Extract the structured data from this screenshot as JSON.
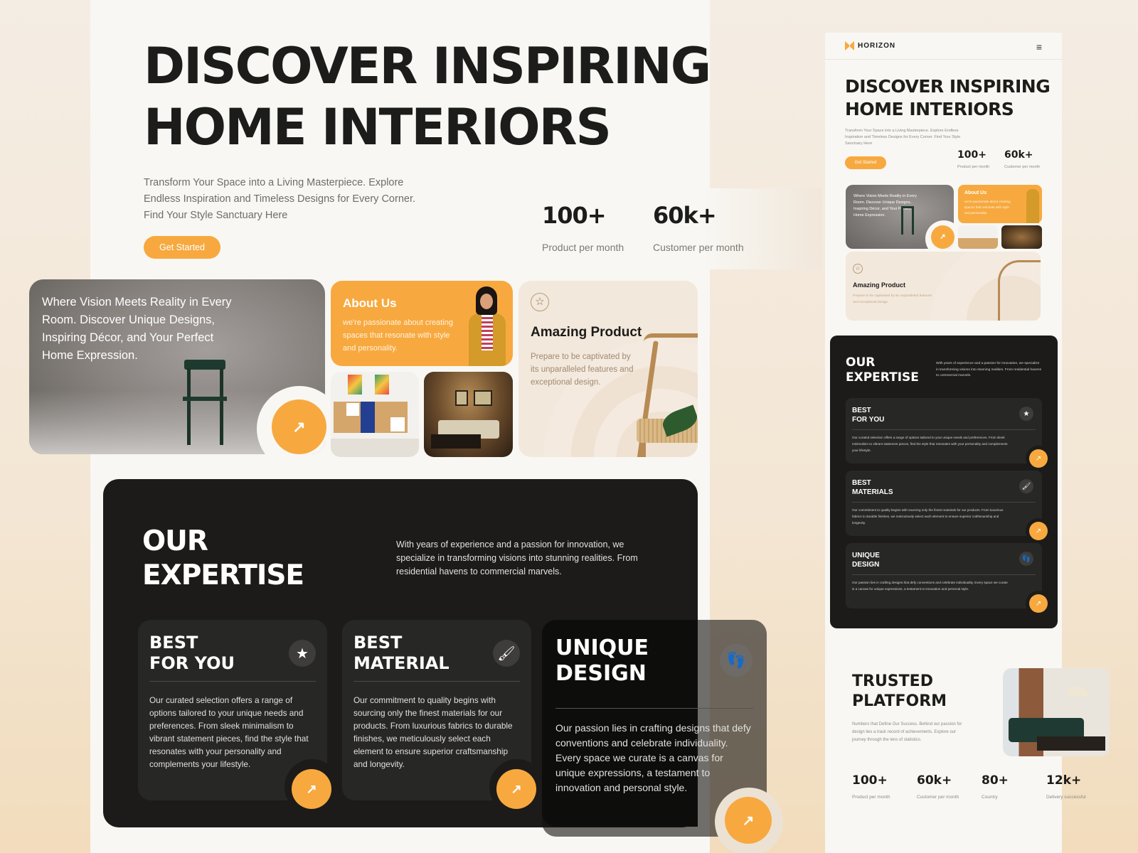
{
  "colors": {
    "accent": "#f7a93f",
    "dark": "#1c1b19",
    "card_dark": "#272725",
    "canvas": "#f8f7f3",
    "text": "#1c1c1a"
  },
  "hero": {
    "title_line1": "DISCOVER INSPIRING",
    "title_line2": "HOME INTERIORS",
    "subtitle": "Transform Your Space into a Living Masterpiece. Explore Endless Inspiration and Timeless Designs for Every Corner. Find Your Style Sanctuary Here",
    "cta_label": "Get Started"
  },
  "stats": [
    {
      "value": "100+",
      "label": "Product per month"
    },
    {
      "value": "60k+",
      "label": "Customer per month"
    }
  ],
  "vision_card": {
    "text": "Where Vision Meets Reality in Every Room. Discover Unique Designs, Inspiring Décor, and Your Perfect Home Expression.",
    "arrow_icon": "arrow-up-right-icon"
  },
  "about_card": {
    "title": "About Us",
    "text": "we're passionate about creating spaces that resonate with style and personality."
  },
  "amazing_card": {
    "icon": "star-outline-icon",
    "title": "Amazing Product",
    "text": "Prepare to be captivated by its unparalleled features and exceptional design."
  },
  "expertise": {
    "title_line1": "OUR",
    "title_line2": "EXPERTISE",
    "description": "With years of experience and a passion for innovation, we specialize in transforming visions into stunning realities. From residential havens to commercial marvels.",
    "cards": [
      {
        "title_line1": "BEST",
        "title_line2": "FOR YOU",
        "icon": "star-icon",
        "text": "Our curated selection offers a range of options tailored to your unique needs and preferences. From sleek minimalism to vibrant statement pieces, find the style that resonates with your personality and complements your lifestyle."
      },
      {
        "title_line1": "BEST",
        "title_line2": "MATERIAL",
        "icon": "paint-roller-icon",
        "text": "Our commitment to quality begins with sourcing only the finest materials for our products. From luxurious fabrics to durable finishes, we meticulously select each element to ensure superior craftsmanship and longevity."
      },
      {
        "title_line1": "UNIQUE",
        "title_line2": "DESIGN",
        "icon": "footprints-icon",
        "text": "Our passion lies in crafting designs that defy conventions and celebrate individuality. Every space we curate is a canvas for unique expressions, a testament to innovation and personal style."
      }
    ]
  },
  "mobile": {
    "brand": "HORIZON",
    "menu_icon": "hamburger-menu-icon",
    "title_line1": "DISCOVER INSPIRING",
    "title_line2": "HOME INTERIORS",
    "subtitle": "Transform Your Space into a Living Masterpiece. Explore Endless Inspiration and Timeless Designs for Every Corner. Find Your Style Sanctuary Here",
    "cta_label": "Get Started",
    "stats": [
      {
        "value": "100+",
        "label": "Product per month"
      },
      {
        "value": "60k+",
        "label": "Customer per month"
      }
    ],
    "vision_text": "Where Vision Meets Reality in Every Room. Discover Unique Designs, Inspiring Décor, and Your Perfect Home Expression.",
    "about_title": "About Us",
    "about_text": "we're passionate about creating spaces that resonate with style and personality.",
    "amazing_title": "Amazing Product",
    "amazing_text": "Prepare to be captivated by its unparalleled features and exceptional design.",
    "expertise_title_line1": "OUR",
    "expertise_title_line2": "EXPERTISE",
    "expertise_desc": "With years of experience and a passion for innovation, we specialize in transforming visions into stunning realities. From residential havens to commercial marvels.",
    "expertise_cards": [
      {
        "title_line1": "BEST",
        "title_line2": "FOR YOU",
        "text": "Our curated selection offers a range of options tailored to your unique needs and preferences. From sleek minimalism to vibrant statement pieces, find the style that resonates with your personality and complements your lifestyle."
      },
      {
        "title_line1": "BEST",
        "title_line2": "MATERIALS",
        "text": "Our commitment to quality begins with sourcing only the finest materials for our products. From luxurious fabrics to durable finishes, we meticulously select each element to ensure superior craftsmanship and longevity."
      },
      {
        "title_line1": "UNIQUE",
        "title_line2": "DESIGN",
        "text": "Our passion lies in crafting designs that defy conventions and celebrate individuality. Every space we curate is a canvas for unique expressions, a testament to innovation and personal style."
      }
    ],
    "trusted_title_line1": "TRUSTED",
    "trusted_title_line2": "PLATFORM",
    "trusted_desc": "Numbers that Define Our Success. Behind our passion for design lies a track record of achievements. Explore our journey through the lens of statistics.",
    "trusted_stats": [
      {
        "value": "100+",
        "label": "Product per month"
      },
      {
        "value": "60k+",
        "label": "Customer per month"
      },
      {
        "value": "80+",
        "label": "Country"
      },
      {
        "value": "12k+",
        "label": "Delivery successful"
      }
    ]
  }
}
